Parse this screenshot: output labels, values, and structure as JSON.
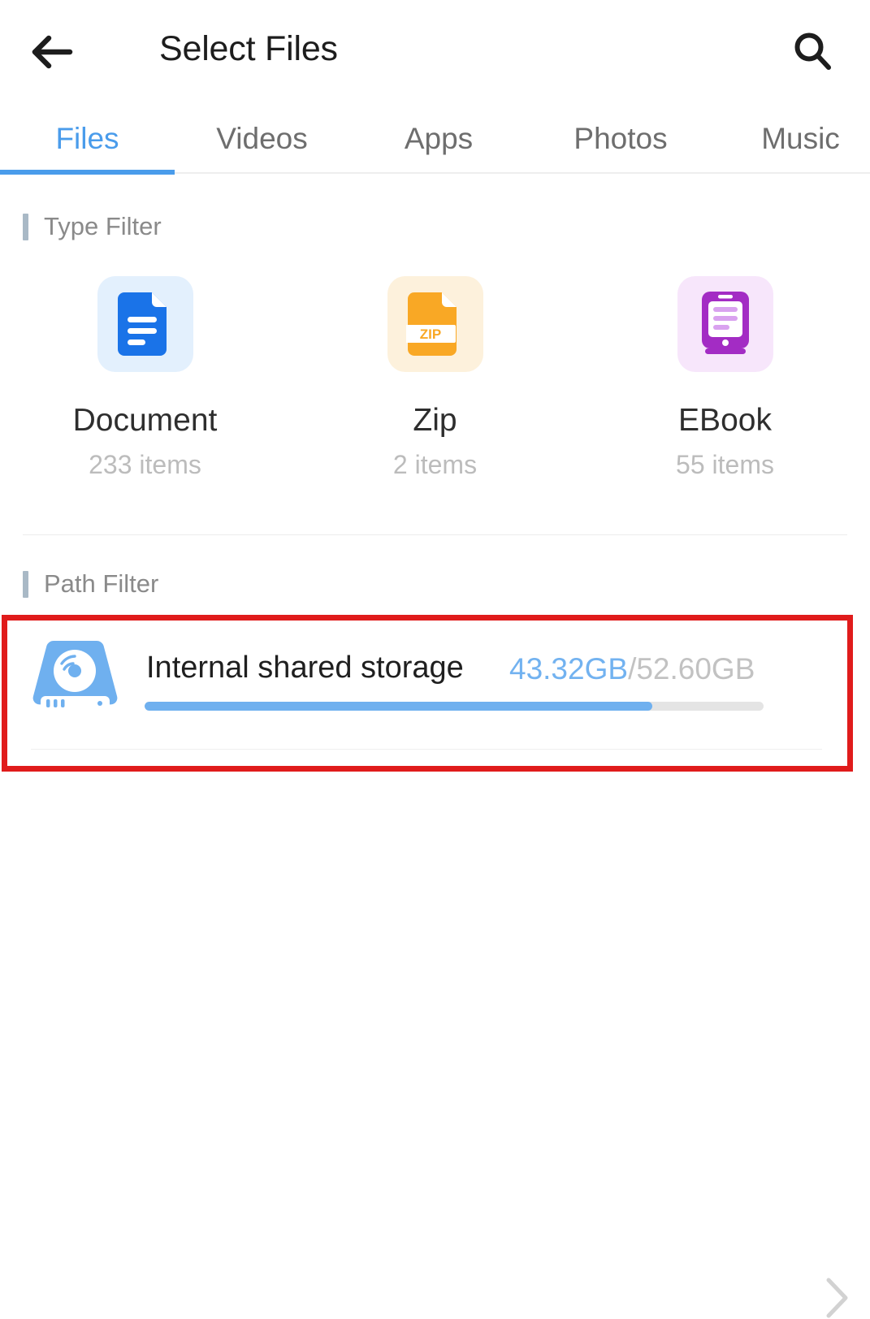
{
  "appbar": {
    "back_icon": "arrow-left-icon",
    "title": "Select Files",
    "search_icon": "search-icon"
  },
  "tabs": [
    {
      "label": "Files",
      "active": true
    },
    {
      "label": "Videos",
      "active": false
    },
    {
      "label": "Apps",
      "active": false
    },
    {
      "label": "Photos",
      "active": false
    },
    {
      "label": "Music",
      "active": false
    }
  ],
  "type_filter": {
    "section_title": "Type Filter",
    "items": [
      {
        "label": "Document",
        "count": "233 items",
        "icon": "document-icon",
        "icon_color": "#1a73e8",
        "bg_color": "#e3f0fd"
      },
      {
        "label": "Zip",
        "count": "2 items",
        "icon": "zip-file-icon",
        "icon_color": "#f9a825",
        "bg_color": "#fdf1dc",
        "badge": "ZIP"
      },
      {
        "label": "EBook",
        "count": "55 items",
        "icon": "ebook-reader-icon",
        "icon_color": "#a32cc4",
        "bg_color": "#f7e6fb"
      }
    ]
  },
  "path_filter": {
    "section_title": "Path Filter",
    "storage": {
      "name": "Internal shared storage",
      "used": "43.32GB",
      "separator": "/",
      "total": "52.60GB",
      "progress_percent": 82,
      "drive_icon": "hard-drive-icon",
      "chevron_icon": "chevron-right-icon"
    }
  },
  "annotation": {
    "highlight_color": "#e01b1b"
  },
  "theme": {
    "accent": "#4a9ceb",
    "tab_inactive": "#6e6e6e",
    "muted_text": "#bcbcbc"
  }
}
